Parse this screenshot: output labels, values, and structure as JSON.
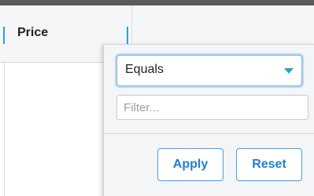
{
  "column_header": {
    "label": "Price"
  },
  "filter_menu": {
    "condition_selected": "Equals",
    "filter_input_value": "",
    "filter_input_placeholder": "Filter...",
    "apply_label": "Apply",
    "reset_label": "Reset"
  },
  "colors": {
    "accent": "#2a9fd8",
    "button_text": "#1f7fd1",
    "popup_background": "#f4f5f6"
  },
  "icons": {
    "dropdown": "caret-down-icon"
  }
}
